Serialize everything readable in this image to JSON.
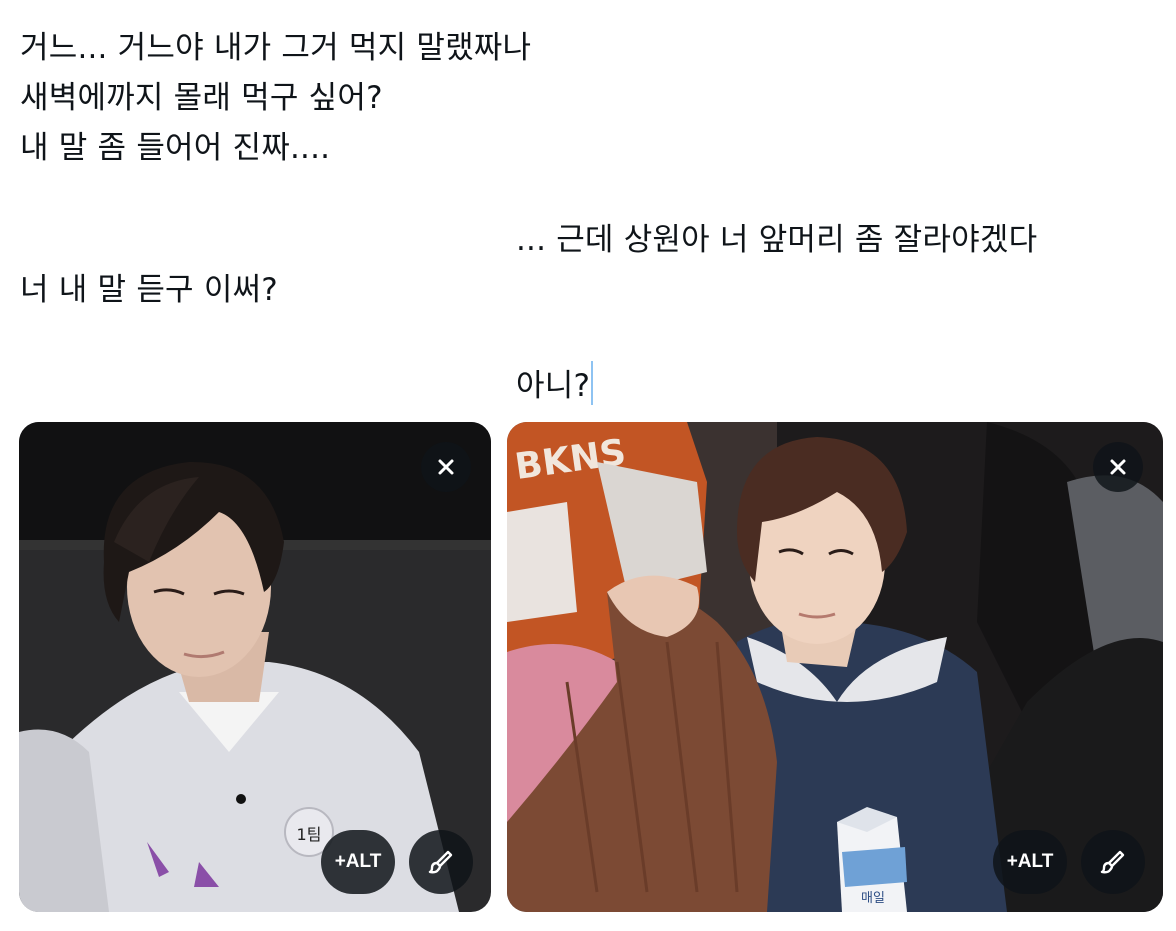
{
  "compose": {
    "lines": [
      "거느... 거느야 내가 그거 먹지 말랬짜나",
      "새벽에까지 몰래 먹구 싶어?",
      "내 말 좀 들어어 진짜....",
      "... 근데 상원아 너 앞머리 좀 잘라야겠다",
      "너 내 말 듣구 이써?",
      "아니?"
    ]
  },
  "attachments": [
    {
      "remove_label": "×",
      "alt_label": "+ALT",
      "edit_icon": "brush-icon",
      "badge_text": "1팀"
    },
    {
      "remove_label": "×",
      "alt_label": "+ALT",
      "edit_icon": "brush-icon",
      "jersey_text": "BKNS",
      "carton_text": "매일"
    }
  ],
  "colors": {
    "text": "#0f1419",
    "caret": "#8ec3f2",
    "button_bg": "#0f1419"
  }
}
